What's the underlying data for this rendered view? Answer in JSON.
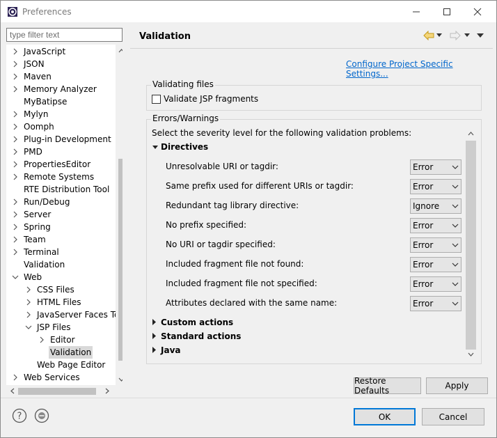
{
  "window": {
    "title": "Preferences"
  },
  "filter": {
    "placeholder": "type filter text"
  },
  "tree": {
    "items": [
      {
        "label": "JavaScript",
        "expander": "collapsed",
        "indent": 0
      },
      {
        "label": "JSON",
        "expander": "collapsed",
        "indent": 0
      },
      {
        "label": "Maven",
        "expander": "collapsed",
        "indent": 0
      },
      {
        "label": "Memory Analyzer",
        "expander": "collapsed",
        "indent": 0
      },
      {
        "label": "MyBatipse",
        "expander": "none",
        "indent": 0
      },
      {
        "label": "Mylyn",
        "expander": "collapsed",
        "indent": 0
      },
      {
        "label": "Oomph",
        "expander": "collapsed",
        "indent": 0
      },
      {
        "label": "Plug-in Development",
        "expander": "collapsed",
        "indent": 0
      },
      {
        "label": "PMD",
        "expander": "collapsed",
        "indent": 0
      },
      {
        "label": "PropertiesEditor",
        "expander": "collapsed",
        "indent": 0
      },
      {
        "label": "Remote Systems",
        "expander": "collapsed",
        "indent": 0
      },
      {
        "label": "RTE Distribution Tool",
        "expander": "none",
        "indent": 0
      },
      {
        "label": "Run/Debug",
        "expander": "collapsed",
        "indent": 0
      },
      {
        "label": "Server",
        "expander": "collapsed",
        "indent": 0
      },
      {
        "label": "Spring",
        "expander": "collapsed",
        "indent": 0
      },
      {
        "label": "Team",
        "expander": "collapsed",
        "indent": 0
      },
      {
        "label": "Terminal",
        "expander": "collapsed",
        "indent": 0
      },
      {
        "label": "Validation",
        "expander": "none",
        "indent": 0
      },
      {
        "label": "Web",
        "expander": "expanded",
        "indent": 0
      },
      {
        "label": "CSS Files",
        "expander": "collapsed",
        "indent": 1
      },
      {
        "label": "HTML Files",
        "expander": "collapsed",
        "indent": 1
      },
      {
        "label": "JavaServer Faces To",
        "expander": "collapsed",
        "indent": 1
      },
      {
        "label": "JSP Files",
        "expander": "expanded",
        "indent": 1
      },
      {
        "label": "Editor",
        "expander": "collapsed",
        "indent": 2
      },
      {
        "label": "Validation",
        "expander": "none",
        "indent": 2,
        "selected": true
      },
      {
        "label": "Web Page Editor",
        "expander": "none",
        "indent": 1
      },
      {
        "label": "Web Services",
        "expander": "collapsed",
        "indent": 0
      }
    ]
  },
  "page": {
    "title": "Validation",
    "configure_link": "Configure Project Specific Settings...",
    "validating_files": {
      "title": "Validating files",
      "validate_jsp_label": "Validate JSP fragments",
      "validate_jsp_checked": false
    },
    "errors_warnings": {
      "title": "Errors/Warnings",
      "description": "Select the severity level for the following validation problems:",
      "directives": {
        "label": "Directives",
        "items": [
          {
            "label": "Unresolvable URI or tagdir:",
            "value": "Error"
          },
          {
            "label": "Same prefix used for different URIs or tagdir:",
            "value": "Error"
          },
          {
            "label": "Redundant tag library directive:",
            "value": "Ignore"
          },
          {
            "label": "No prefix specified:",
            "value": "Error"
          },
          {
            "label": "No URI or tagdir specified:",
            "value": "Error"
          },
          {
            "label": "Included fragment file not found:",
            "value": "Error"
          },
          {
            "label": "Included fragment file not specified:",
            "value": "Error"
          },
          {
            "label": "Attributes declared with the same name:",
            "value": "Error"
          }
        ]
      },
      "collapsed_sections": [
        "Custom actions",
        "Standard actions",
        "Java"
      ]
    },
    "restore_defaults_label": "Restore Defaults",
    "apply_label": "Apply"
  },
  "footer": {
    "ok_label": "OK",
    "cancel_label": "Cancel"
  },
  "colors": {
    "link": "#0066cc",
    "selection": "#d9d9d9",
    "default_button_border": "#0078d7"
  }
}
